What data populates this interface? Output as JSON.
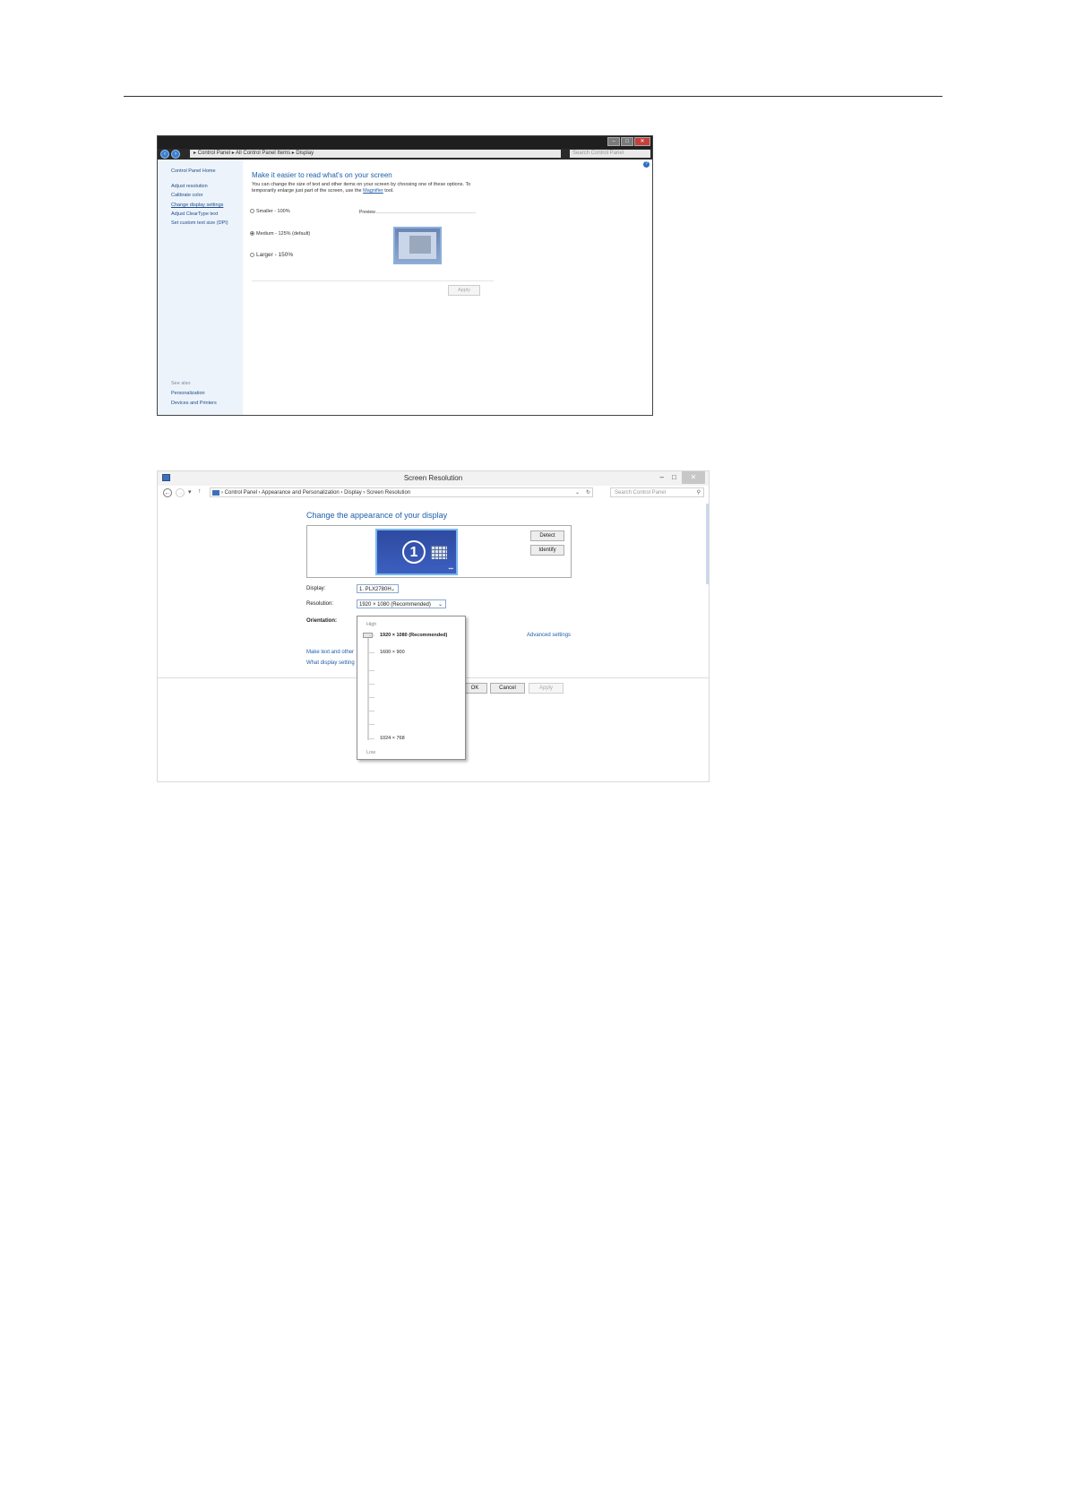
{
  "win7_display": {
    "window_controls": [
      "–",
      "□",
      "✕"
    ],
    "breadcrumb": "▸ Control Panel ▸ All Control Panel Items ▸ Display",
    "search_placeholder": "Search Control Panel",
    "sidebar": {
      "home": "Control Panel Home",
      "items": [
        "Adjust resolution",
        "Calibrate color",
        "Change display settings",
        "Adjust ClearType text",
        "Set custom text size (DPI)"
      ],
      "see_also_label": "See also",
      "see_also": [
        "Personalization",
        "Devices and Printers"
      ]
    },
    "heading": "Make it easier to read what's on your screen",
    "description": "You can change the size of text and other items on your screen by choosing one of these options. To temporarily enlarge just part of the screen, use the",
    "magnifier_link": "Magnifier",
    "description_tail": "tool.",
    "options": [
      {
        "label": "Smaller - 100%",
        "selected": false
      },
      {
        "label": "Medium - 125% (default)",
        "selected": true
      },
      {
        "label": "Larger - 150%",
        "selected": false
      }
    ],
    "preview_label": "Preview",
    "apply_label": "Apply"
  },
  "win8_resolution": {
    "title": "Screen Resolution",
    "window_controls": [
      "–",
      "□",
      "✕"
    ],
    "address": "› Control Panel › Appearance and Personalization › Display › Screen Resolution",
    "search_placeholder": "Search Control Panel",
    "heading": "Change the appearance of your display",
    "monitor_number": "1",
    "detect_label": "Detect",
    "identify_label": "Identify",
    "display_label": "Display:",
    "display_value": "1. PLX2780H",
    "resolution_label": "Resolution:",
    "resolution_value": "1920 × 1080 (Recommended)",
    "orientation_label": "Orientation:",
    "advanced_link": "Advanced settings",
    "make_text_link": "Make text and other",
    "what_display_link": "What display setting",
    "ok_label": "OK",
    "cancel_label": "Cancel",
    "apply_label": "Apply",
    "dropdown": {
      "high_label": "High",
      "low_label": "Low",
      "options": [
        "1920 × 1080 (Recommended)",
        "1600 × 900",
        "1024 × 768"
      ],
      "selected": "1920 × 1080 (Recommended)"
    }
  }
}
